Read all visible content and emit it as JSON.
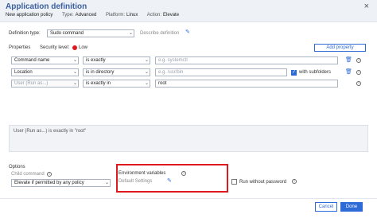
{
  "header": {
    "title": "Application definition",
    "policy": "New application policy",
    "type_label": "Type:",
    "type_value": "Advanced",
    "platform_label": "Platform:",
    "platform_value": "Linux",
    "action_label": "Action:",
    "action_value": "Elevate",
    "close": "×"
  },
  "definition": {
    "label": "Definition type:",
    "value": "Sudo command",
    "level": "Low",
    "describe": "Describe definition"
  },
  "properties": {
    "label": "Properties",
    "security_label": "Security level:",
    "security_value": "Low",
    "add_button": "Add property",
    "rows": [
      {
        "name": "Command name",
        "op": "is exactly",
        "value": "e.g. systemctl",
        "value_placeholder": true
      },
      {
        "name": "Location",
        "op": "is in directory",
        "value": "e.g. /usr/bin",
        "value_placeholder": true,
        "checkbox_label": "with subfolders"
      },
      {
        "name": "User (Run as...)",
        "op": "is exactly in",
        "value": "root",
        "value_placeholder": false
      }
    ]
  },
  "summary": "User (Run as...) is exactly in \"root\"",
  "options": {
    "label": "Options",
    "child_label": "Child command",
    "child_value": "Elevate if permitted by any policy",
    "env_label": "Environment variables",
    "env_value": "Default Settings",
    "run_without_password": "Run without password"
  },
  "footer": {
    "cancel": "Cancel",
    "done": "Done"
  },
  "colors": {
    "accent": "#2f6bd6",
    "danger": "#e0191f",
    "title": "#3b5f9e"
  }
}
